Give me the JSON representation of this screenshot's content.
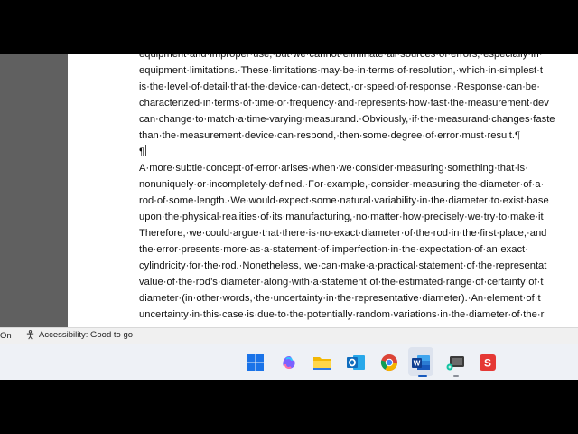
{
  "document": {
    "lines": [
      "equipment·and·improper·use,·but·we·cannot·eliminate·all·sources·of·errors,·especially·in·",
      "equipment·limitations.·These·limitations·may·be·in·terms·of·resolution,·which·in·simplest·t",
      "is·the·level·of·detail·that·the·device·can·detect,·or·speed·of·response.·Response·can·be·",
      "characterized·in·terms·of·time·or·frequency·and·represents·how·fast·the·measurement·dev",
      "can·change·to·match·a·time-varying·measurand.·Obviously,·if·the·measurand·changes·faste",
      "than·the·measurement·device·can·respond,·then·some·degree·of·error·must·result.¶",
      "¶",
      "A·more·subtle·concept·of·error·arises·when·we·consider·measuring·something·that·is·",
      "nonuniquely·or·incompletely·defined.·For·example,·consider·measuring·the·diameter·of·a·",
      "rod·of·some·length.·We·would·expect·some·natural·variability·in·the·diameter·to·exist·base",
      "upon·the·physical·realities·of·its·manufacturing,·no·matter·how·precisely·we·try·to·make·it",
      "Therefore,·we·could·argue·that·there·is·no·exact·diameter·of·the·rod·in·the·first·place,·and",
      "the·error·presents·more·as·a·statement·of·imperfection·in·the·expectation·of·an·exact·",
      "cylindricity·for·the·rod.·Nonetheless,·we·can·make·a·practical·statement·of·the·representat",
      "value·of·the·rod’s·diameter·along·with·a·statement·of·the·estimated·range·of·certainty·of·t",
      "diameter·(in·other·words,·the·uncertainty·in·the·representative·diameter).·An·element·of·t",
      "uncertainty·in·this·case·is·due·to·the·potentially·random·variations·in·the·diameter·of·the·r"
    ]
  },
  "statusbar": {
    "left_text": "On",
    "accessibility_text": "Accessibility: Good to go"
  },
  "taskbar": {
    "icons": [
      {
        "name": "windows-start-icon",
        "color": "#1a73e8"
      },
      {
        "name": "copilot-icon",
        "color": "#7b61ff"
      },
      {
        "name": "file-explorer-icon",
        "color": "#f2b705"
      },
      {
        "name": "outlook-icon",
        "color": "#0f6cbd"
      },
      {
        "name": "chrome-icon",
        "color": "#db4437"
      },
      {
        "name": "word-icon",
        "color": "#185abd"
      },
      {
        "name": "snipping-tool-icon",
        "color": "#2d2d2d"
      },
      {
        "name": "wps-office-icon",
        "color": "#e53935"
      }
    ]
  }
}
